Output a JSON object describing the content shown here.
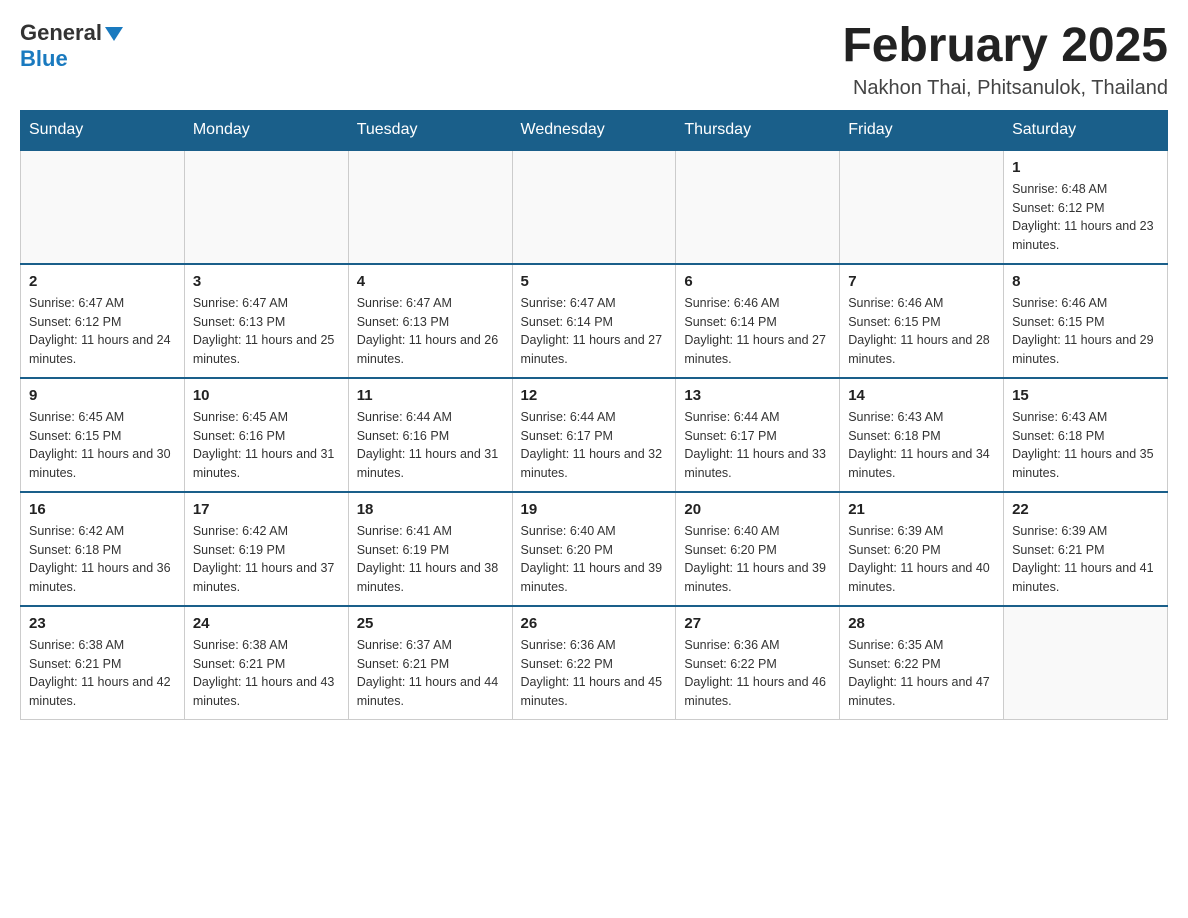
{
  "header": {
    "logo": {
      "general": "General",
      "blue": "Blue"
    },
    "title": "February 2025",
    "location": "Nakhon Thai, Phitsanulok, Thailand"
  },
  "weekdays": [
    "Sunday",
    "Monday",
    "Tuesday",
    "Wednesday",
    "Thursday",
    "Friday",
    "Saturday"
  ],
  "weeks": [
    [
      {
        "day": "",
        "info": ""
      },
      {
        "day": "",
        "info": ""
      },
      {
        "day": "",
        "info": ""
      },
      {
        "day": "",
        "info": ""
      },
      {
        "day": "",
        "info": ""
      },
      {
        "day": "",
        "info": ""
      },
      {
        "day": "1",
        "info": "Sunrise: 6:48 AM\nSunset: 6:12 PM\nDaylight: 11 hours and 23 minutes."
      }
    ],
    [
      {
        "day": "2",
        "info": "Sunrise: 6:47 AM\nSunset: 6:12 PM\nDaylight: 11 hours and 24 minutes."
      },
      {
        "day": "3",
        "info": "Sunrise: 6:47 AM\nSunset: 6:13 PM\nDaylight: 11 hours and 25 minutes."
      },
      {
        "day": "4",
        "info": "Sunrise: 6:47 AM\nSunset: 6:13 PM\nDaylight: 11 hours and 26 minutes."
      },
      {
        "day": "5",
        "info": "Sunrise: 6:47 AM\nSunset: 6:14 PM\nDaylight: 11 hours and 27 minutes."
      },
      {
        "day": "6",
        "info": "Sunrise: 6:46 AM\nSunset: 6:14 PM\nDaylight: 11 hours and 27 minutes."
      },
      {
        "day": "7",
        "info": "Sunrise: 6:46 AM\nSunset: 6:15 PM\nDaylight: 11 hours and 28 minutes."
      },
      {
        "day": "8",
        "info": "Sunrise: 6:46 AM\nSunset: 6:15 PM\nDaylight: 11 hours and 29 minutes."
      }
    ],
    [
      {
        "day": "9",
        "info": "Sunrise: 6:45 AM\nSunset: 6:15 PM\nDaylight: 11 hours and 30 minutes."
      },
      {
        "day": "10",
        "info": "Sunrise: 6:45 AM\nSunset: 6:16 PM\nDaylight: 11 hours and 31 minutes."
      },
      {
        "day": "11",
        "info": "Sunrise: 6:44 AM\nSunset: 6:16 PM\nDaylight: 11 hours and 31 minutes."
      },
      {
        "day": "12",
        "info": "Sunrise: 6:44 AM\nSunset: 6:17 PM\nDaylight: 11 hours and 32 minutes."
      },
      {
        "day": "13",
        "info": "Sunrise: 6:44 AM\nSunset: 6:17 PM\nDaylight: 11 hours and 33 minutes."
      },
      {
        "day": "14",
        "info": "Sunrise: 6:43 AM\nSunset: 6:18 PM\nDaylight: 11 hours and 34 minutes."
      },
      {
        "day": "15",
        "info": "Sunrise: 6:43 AM\nSunset: 6:18 PM\nDaylight: 11 hours and 35 minutes."
      }
    ],
    [
      {
        "day": "16",
        "info": "Sunrise: 6:42 AM\nSunset: 6:18 PM\nDaylight: 11 hours and 36 minutes."
      },
      {
        "day": "17",
        "info": "Sunrise: 6:42 AM\nSunset: 6:19 PM\nDaylight: 11 hours and 37 minutes."
      },
      {
        "day": "18",
        "info": "Sunrise: 6:41 AM\nSunset: 6:19 PM\nDaylight: 11 hours and 38 minutes."
      },
      {
        "day": "19",
        "info": "Sunrise: 6:40 AM\nSunset: 6:20 PM\nDaylight: 11 hours and 39 minutes."
      },
      {
        "day": "20",
        "info": "Sunrise: 6:40 AM\nSunset: 6:20 PM\nDaylight: 11 hours and 39 minutes."
      },
      {
        "day": "21",
        "info": "Sunrise: 6:39 AM\nSunset: 6:20 PM\nDaylight: 11 hours and 40 minutes."
      },
      {
        "day": "22",
        "info": "Sunrise: 6:39 AM\nSunset: 6:21 PM\nDaylight: 11 hours and 41 minutes."
      }
    ],
    [
      {
        "day": "23",
        "info": "Sunrise: 6:38 AM\nSunset: 6:21 PM\nDaylight: 11 hours and 42 minutes."
      },
      {
        "day": "24",
        "info": "Sunrise: 6:38 AM\nSunset: 6:21 PM\nDaylight: 11 hours and 43 minutes."
      },
      {
        "day": "25",
        "info": "Sunrise: 6:37 AM\nSunset: 6:21 PM\nDaylight: 11 hours and 44 minutes."
      },
      {
        "day": "26",
        "info": "Sunrise: 6:36 AM\nSunset: 6:22 PM\nDaylight: 11 hours and 45 minutes."
      },
      {
        "day": "27",
        "info": "Sunrise: 6:36 AM\nSunset: 6:22 PM\nDaylight: 11 hours and 46 minutes."
      },
      {
        "day": "28",
        "info": "Sunrise: 6:35 AM\nSunset: 6:22 PM\nDaylight: 11 hours and 47 minutes."
      },
      {
        "day": "",
        "info": ""
      }
    ]
  ]
}
